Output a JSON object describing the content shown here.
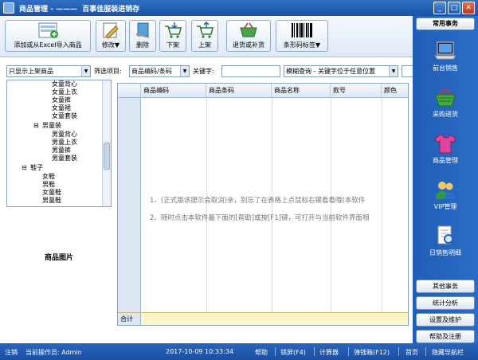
{
  "window": {
    "title": "商品管理 - ———  百事佳服装进销存"
  },
  "toolbar": {
    "import_excel": "添加或从Excel导入商品",
    "edit": "修改▼",
    "delete": "删除",
    "take_down": "下架",
    "put_up": "上架",
    "return_exchange": "退货或补货",
    "barcode_label": "条形码标签▼"
  },
  "filter": {
    "status_select": "只显示上架商品",
    "field_label": "筛选项目:",
    "field_select": "商品编码/条码",
    "keyword_label": "关键字:",
    "keyword_value": "",
    "mode_select": "模糊查询 - 关键字位于任意位置"
  },
  "tree": {
    "women_items": [
      "女童背心",
      "女童上衣",
      "女童裤",
      "女童裙",
      "女童套装"
    ],
    "boys_group": "男童装",
    "boys_items": [
      "男童背心",
      "男童上衣",
      "男童裤",
      "男童套装"
    ],
    "shoes_group": "鞋子",
    "shoes_items": [
      "女鞋",
      "男鞋",
      "女童鞋",
      "男童鞋"
    ]
  },
  "product_image": {
    "label": "商品图片"
  },
  "grid": {
    "columns": [
      "商品编码",
      "商品条码",
      "商品名称",
      "款号",
      "颜色"
    ],
    "hints": [
      "1、(正式版该提示会取消)亲，别忘了在表格上点鼠标右键看看哦(本软件",
      "2、随时点击本软件最下面的[帮助]或按[F1]键，可打开与当前软件界面相"
    ],
    "total_label": "合计"
  },
  "sidebar": {
    "header": "常用事务",
    "items": [
      {
        "label": "前台销售",
        "icon": "laptop-icon"
      },
      {
        "label": "采购进货",
        "icon": "basket-icon"
      },
      {
        "label": "商品管理",
        "icon": "tshirt-icon"
      },
      {
        "label": "VIP管理",
        "icon": "users-icon"
      },
      {
        "label": "日销售明细",
        "icon": "magnifier-doc-icon"
      }
    ],
    "buttons": [
      "其他事务",
      "统计分析",
      "设置及维护",
      "帮助及注册"
    ]
  },
  "status": {
    "logout": "注销",
    "operator": "当前操作员: Admin",
    "datetime": "2017-10-09 10:33:34",
    "help": "帮助",
    "lock": "锁屏(F4)",
    "calculator": "计算器",
    "cash_drawer": "弹钱箱(F12)",
    "home": "首页",
    "hide_nav": "隐藏导航栏"
  },
  "colors": {
    "titlebar": "#1c52a6",
    "sidebar": "#2b6cc6",
    "total_row": "#fff4c6"
  }
}
